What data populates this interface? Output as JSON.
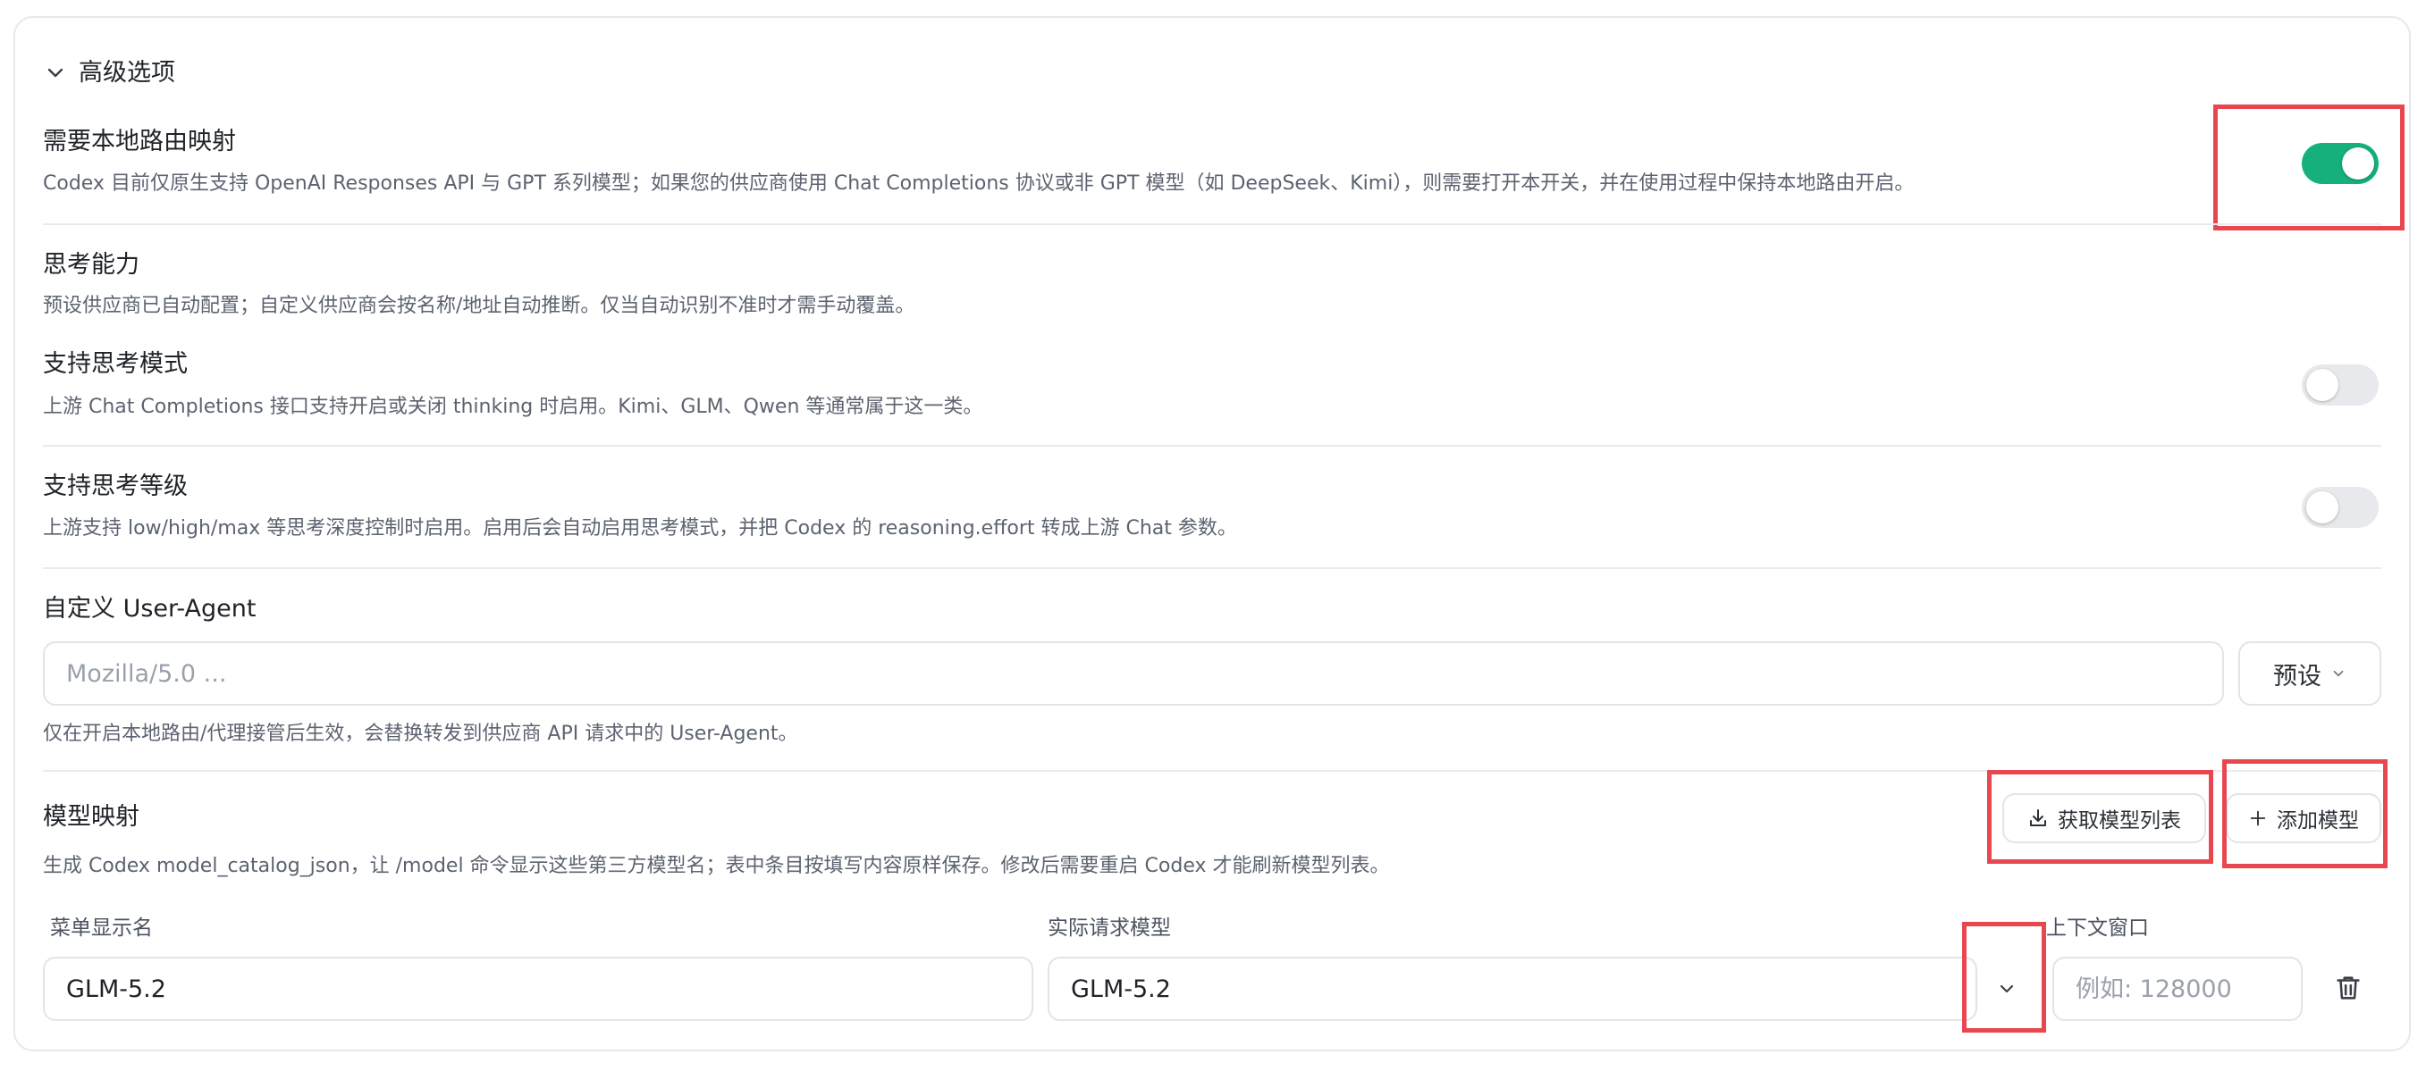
{
  "section": {
    "title": "高级选项"
  },
  "local_routing": {
    "title": "需要本地路由映射",
    "desc": "Codex 目前仅原生支持 OpenAI Responses API 与 GPT 系列模型；如果您的供应商使用 Chat Completions 协议或非 GPT 模型（如 DeepSeek、Kimi），则需要打开本开关，并在使用过程中保持本地路由开启。",
    "enabled": true
  },
  "thinking": {
    "title": "思考能力",
    "desc": "预设供应商已自动配置；自定义供应商会按名称/地址自动推断。仅当自动识别不准时才需手动覆盖。"
  },
  "thinking_mode": {
    "title": "支持思考模式",
    "desc": "上游 Chat Completions 接口支持开启或关闭 thinking 时启用。Kimi、GLM、Qwen 等通常属于这一类。",
    "enabled": false
  },
  "thinking_level": {
    "title": "支持思考等级",
    "desc": "上游支持 low/high/max 等思考深度控制时启用。启用后会自动启用思考模式，并把 Codex 的 reasoning.effort 转成上游 Chat 参数。",
    "enabled": false
  },
  "user_agent": {
    "title": "自定义 User-Agent",
    "placeholder": "Mozilla/5.0 ...",
    "preset_label": "预设",
    "note": "仅在开启本地路由/代理接管后生效，会替换转发到供应商 API 请求中的 User-Agent。"
  },
  "model_mapping": {
    "title": "模型映射",
    "fetch_label": "获取模型列表",
    "add_label": "添加模型",
    "desc": "生成 Codex model_catalog_json，让 /model 命令显示这些第三方模型名；表中条目按填写内容原样保存。修改后需要重启 Codex 才能刷新模型列表。",
    "columns": {
      "display_name": "菜单显示名",
      "request_model": "实际请求模型",
      "context_window": "上下文窗口"
    },
    "rows": [
      {
        "display_name": "GLM-5.2",
        "request_model": "GLM-5.2",
        "context_placeholder": "例如: 128000"
      }
    ]
  },
  "colors": {
    "accent_green": "#16b07c",
    "highlight_red": "#e7474f"
  }
}
